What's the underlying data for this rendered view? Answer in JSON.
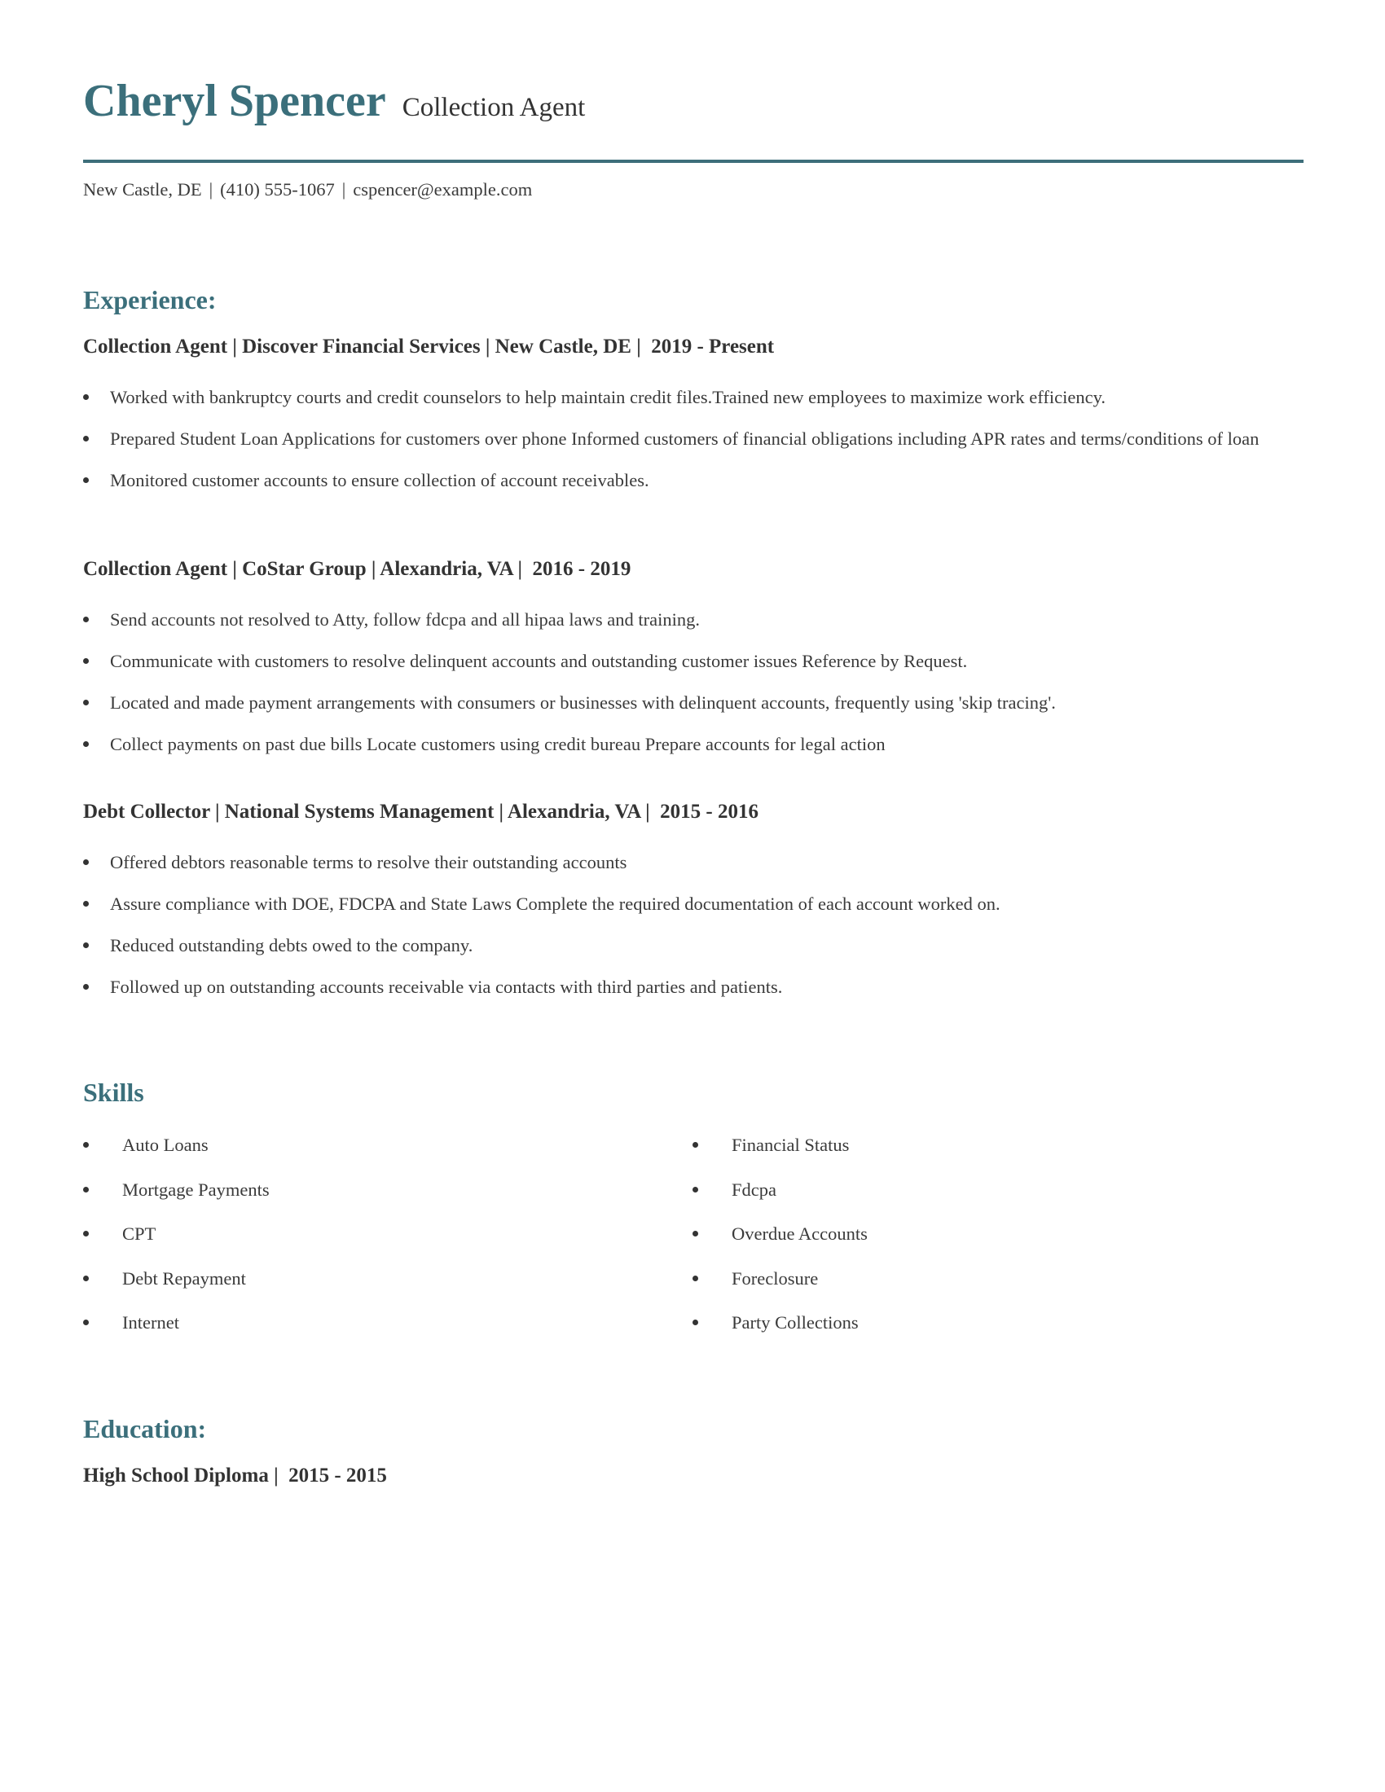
{
  "header": {
    "name": "Cheryl Spencer",
    "title": "Collection Agent",
    "contact": {
      "location": "New Castle, DE",
      "phone": "(410) 555-1067",
      "email": "cspencer@example.com",
      "separator": "|"
    }
  },
  "colors": {
    "accent": "#3b6f7b",
    "text": "#333333"
  },
  "experience": {
    "heading": "Experience:",
    "jobs": [
      {
        "title_line": "Collection Agent | Discover Financial Services | New Castle, DE |  2019 - Present",
        "bullets": [
          "Worked with bankruptcy courts and credit counselors to help maintain credit files.Trained new employees to maximize work efficiency.",
          "Prepared Student Loan Applications for customers over phone Informed customers of financial obligations including APR rates and terms/conditions of loan",
          "Monitored customer accounts to ensure collection of account receivables."
        ]
      },
      {
        "title_line": "Collection Agent | CoStar Group | Alexandria, VA |  2016 - 2019",
        "bullets": [
          "Send accounts not resolved to Atty, follow fdcpa and all hipaa laws and training.",
          "Communicate with customers to resolve delinquent accounts and outstanding customer issues Reference by Request.",
          "Located and made payment arrangements with consumers or businesses with delinquent accounts, frequently using 'skip tracing'.",
          "Collect payments on past due bills Locate customers using credit bureau Prepare accounts for legal action"
        ]
      },
      {
        "title_line": "Debt Collector | National Systems Management | Alexandria, VA |  2015 - 2016",
        "bullets": [
          "Offered debtors reasonable terms to resolve their outstanding accounts",
          "Assure compliance with DOE, FDCPA and State Laws Complete the required documentation of each account worked on.",
          "Reduced outstanding debts owed to the company.",
          "Followed up on outstanding accounts receivable via contacts with third parties and patients."
        ]
      }
    ]
  },
  "skills": {
    "heading": "Skills",
    "left": [
      "Auto Loans",
      "Mortgage Payments",
      "CPT",
      "Debt Repayment",
      "Internet"
    ],
    "right": [
      "Financial Status",
      "Fdcpa",
      "Overdue Accounts",
      "Foreclosure",
      "Party Collections"
    ]
  },
  "education": {
    "heading": "Education:",
    "items": [
      {
        "title_line": "High School Diploma |  2015 - 2015"
      }
    ]
  }
}
